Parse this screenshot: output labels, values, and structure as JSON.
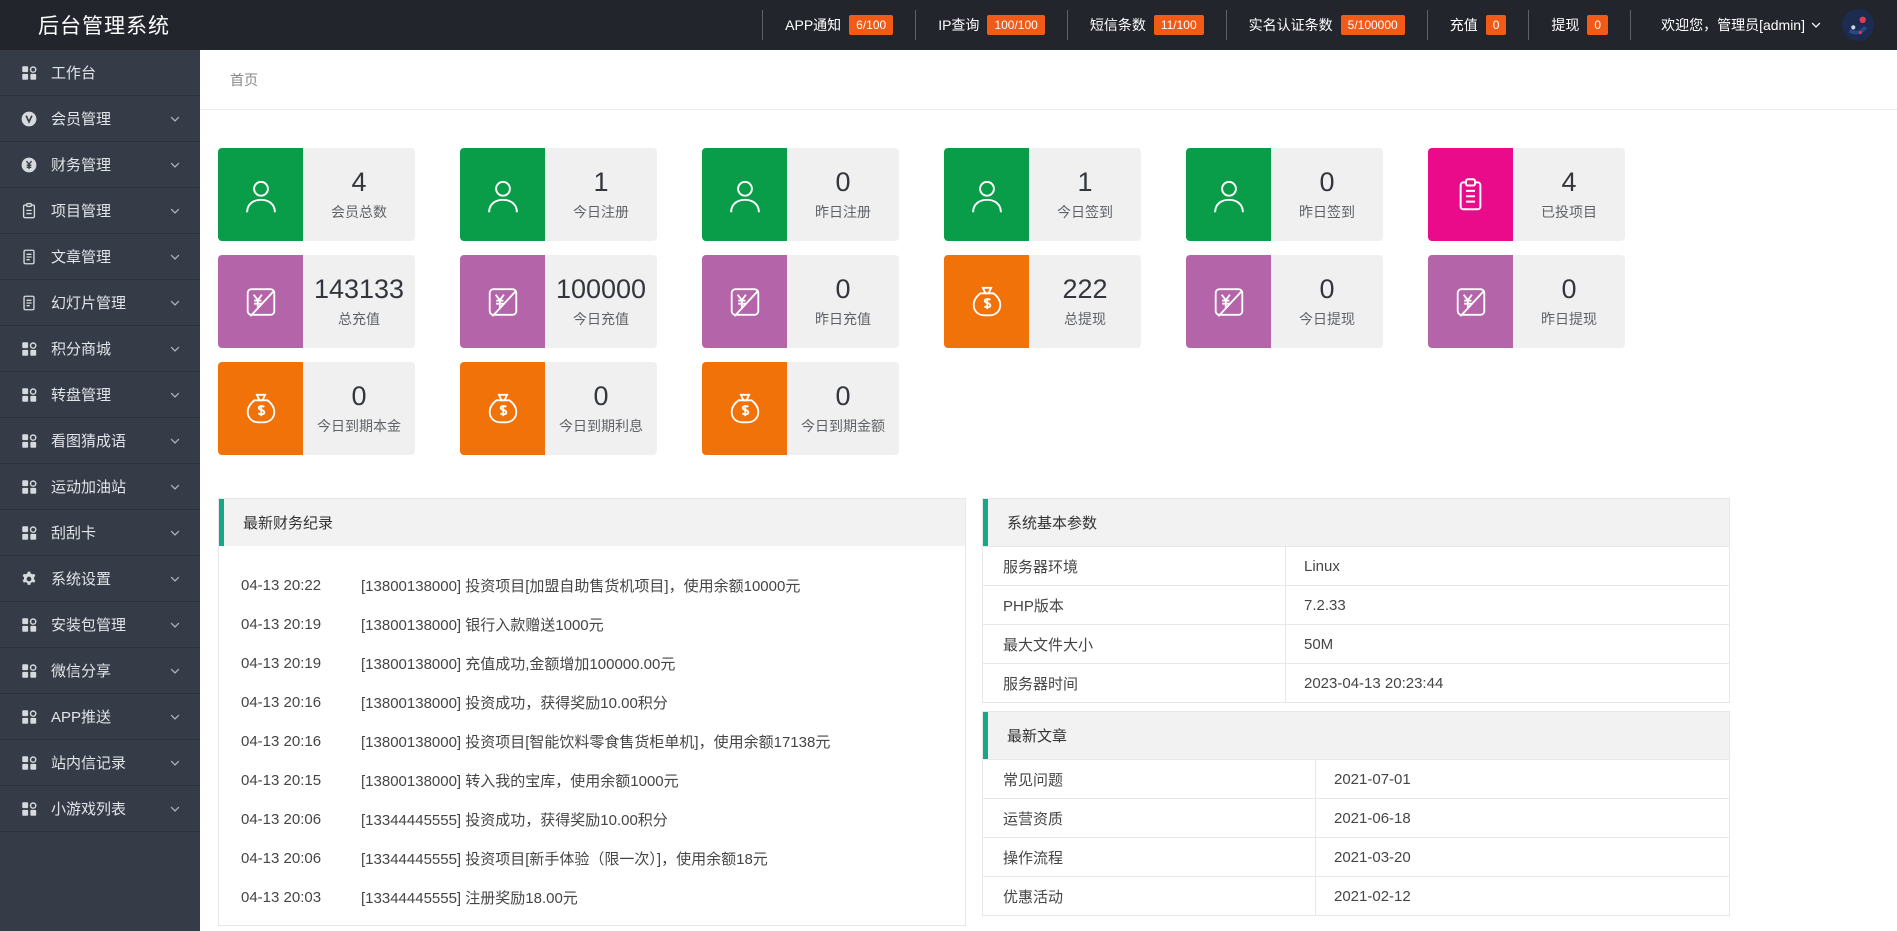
{
  "colors": {
    "badge": "#f25a17",
    "accent": "#18a689",
    "green": "#0a9d49",
    "pink": "#e90b8a",
    "purple": "#b464a9",
    "orange": "#f07209"
  },
  "topbar": {
    "title": "后台管理系统",
    "stats": [
      {
        "label": "APP通知",
        "badge": "6/100"
      },
      {
        "label": "IP查询",
        "badge": "100/100"
      },
      {
        "label": "短信条数",
        "badge": "11/100"
      },
      {
        "label": "实名认证条数",
        "badge": "5/100000"
      },
      {
        "label": "充值",
        "badge": "0"
      },
      {
        "label": "提现",
        "badge": "0"
      }
    ],
    "welcome": "欢迎您，管理员[admin]"
  },
  "sidebar": {
    "items": [
      {
        "label": "工作台",
        "icon": "grid-icon",
        "expandable": false
      },
      {
        "label": "会员管理",
        "icon": "user-circle-icon",
        "expandable": true
      },
      {
        "label": "财务管理",
        "icon": "yen-circle-icon",
        "expandable": true
      },
      {
        "label": "项目管理",
        "icon": "clipboard-icon",
        "expandable": true
      },
      {
        "label": "文章管理",
        "icon": "document-icon",
        "expandable": true
      },
      {
        "label": "幻灯片管理",
        "icon": "document-icon",
        "expandable": true
      },
      {
        "label": "积分商城",
        "icon": "grid-icon",
        "expandable": true
      },
      {
        "label": "转盘管理",
        "icon": "grid-icon",
        "expandable": true
      },
      {
        "label": "看图猜成语",
        "icon": "grid-icon",
        "expandable": true
      },
      {
        "label": "运动加油站",
        "icon": "grid-icon",
        "expandable": true
      },
      {
        "label": "刮刮卡",
        "icon": "grid-icon",
        "expandable": true
      },
      {
        "label": "系统设置",
        "icon": "gear-icon",
        "expandable": true
      },
      {
        "label": "安装包管理",
        "icon": "grid-icon",
        "expandable": true
      },
      {
        "label": "微信分享",
        "icon": "grid-icon",
        "expandable": true
      },
      {
        "label": "APP推送",
        "icon": "grid-icon",
        "expandable": true
      },
      {
        "label": "站内信记录",
        "icon": "grid-icon",
        "expandable": true
      },
      {
        "label": "小游戏列表",
        "icon": "grid-icon",
        "expandable": true
      }
    ]
  },
  "breadcrumb": "首页",
  "stat_cards": [
    {
      "value": "4",
      "label": "会员总数",
      "icon": "user-icon",
      "color": "#0a9d49"
    },
    {
      "value": "1",
      "label": "今日注册",
      "icon": "user-icon",
      "color": "#0a9d49"
    },
    {
      "value": "0",
      "label": "昨日注册",
      "icon": "user-icon",
      "color": "#0a9d49"
    },
    {
      "value": "1",
      "label": "今日签到",
      "icon": "user-icon",
      "color": "#0a9d49"
    },
    {
      "value": "0",
      "label": "昨日签到",
      "icon": "user-icon",
      "color": "#0a9d49"
    },
    {
      "value": "4",
      "label": "已投项目",
      "icon": "clipboard-list-icon",
      "color": "#e90b8a"
    },
    {
      "value": "143133",
      "label": "总充值",
      "icon": "recharge-icon",
      "color": "#b464a9"
    },
    {
      "value": "100000",
      "label": "今日充值",
      "icon": "recharge-icon",
      "color": "#b464a9"
    },
    {
      "value": "0",
      "label": "昨日充值",
      "icon": "recharge-icon",
      "color": "#b464a9"
    },
    {
      "value": "222",
      "label": "总提现",
      "icon": "moneybag-icon",
      "color": "#f07209"
    },
    {
      "value": "0",
      "label": "今日提现",
      "icon": "recharge-icon",
      "color": "#b464a9"
    },
    {
      "value": "0",
      "label": "昨日提现",
      "icon": "recharge-icon",
      "color": "#b464a9"
    },
    {
      "value": "0",
      "label": "今日到期本金",
      "icon": "moneybag-icon",
      "color": "#f07209"
    },
    {
      "value": "0",
      "label": "今日到期利息",
      "icon": "moneybag-icon",
      "color": "#f07209"
    },
    {
      "value": "0",
      "label": "今日到期金额",
      "icon": "moneybag-icon",
      "color": "#f07209"
    }
  ],
  "finance_panel": {
    "title": "最新财务纪录",
    "records": [
      {
        "time": "04-13 20:22",
        "text": "[13800138000] 投资项目[加盟自助售货机项目]，使用余额10000元"
      },
      {
        "time": "04-13 20:19",
        "text": "[13800138000] 银行入款赠送1000元"
      },
      {
        "time": "04-13 20:19",
        "text": "[13800138000] 充值成功,金额增加100000.00元"
      },
      {
        "time": "04-13 20:16",
        "text": "[13800138000] 投资成功，获得奖励10.00积分"
      },
      {
        "time": "04-13 20:16",
        "text": "[13800138000] 投资项目[智能饮料零食售货柜单机]，使用余额17138元"
      },
      {
        "time": "04-13 20:15",
        "text": "[13800138000] 转入我的宝库，使用余额1000元"
      },
      {
        "time": "04-13 20:06",
        "text": "[13344445555] 投资成功，获得奖励10.00积分"
      },
      {
        "time": "04-13 20:06",
        "text": "[13344445555] 投资项目[新手体验（限一次）]，使用余额18元"
      },
      {
        "time": "04-13 20:03",
        "text": "[13344445555] 注册奖励18.00元"
      }
    ]
  },
  "system_panel": {
    "title": "系统基本参数",
    "rows": [
      {
        "name": "服务器环境",
        "value": "Linux"
      },
      {
        "name": "PHP版本",
        "value": "7.2.33"
      },
      {
        "name": "最大文件大小",
        "value": "50M"
      },
      {
        "name": "服务器时间",
        "value": "2023-04-13 20:23:44"
      }
    ]
  },
  "articles_panel": {
    "title": "最新文章",
    "rows": [
      {
        "name": "常见问题",
        "value": "2021-07-01"
      },
      {
        "name": "运营资质",
        "value": "2021-06-18"
      },
      {
        "name": "操作流程",
        "value": "2021-03-20"
      },
      {
        "name": "优惠活动",
        "value": "2021-02-12"
      }
    ]
  }
}
